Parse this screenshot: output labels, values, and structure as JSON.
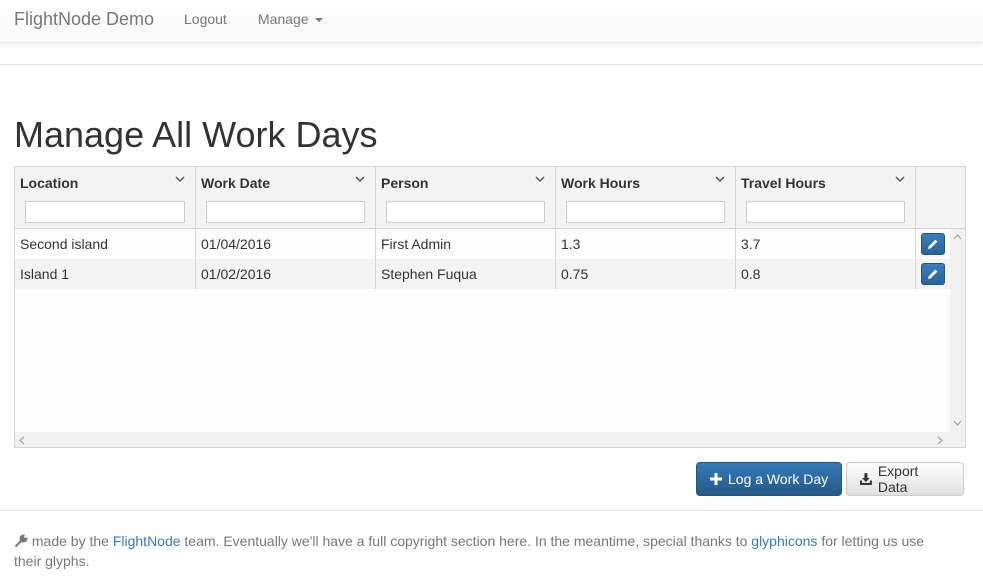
{
  "navbar": {
    "brand": "FlightNode Demo",
    "logout": "Logout",
    "manage": "Manage"
  },
  "page_title": "Manage All Work Days",
  "grid": {
    "columns": [
      {
        "label": "Location",
        "filter": ""
      },
      {
        "label": "Work Date",
        "filter": ""
      },
      {
        "label": "Person",
        "filter": ""
      },
      {
        "label": "Work Hours",
        "filter": ""
      },
      {
        "label": "Travel Hours",
        "filter": ""
      }
    ],
    "rows": [
      {
        "location": "Second island",
        "work_date": "01/04/2016",
        "person": "First Admin",
        "work_hours": "1.3",
        "travel_hours": "3.7"
      },
      {
        "location": "Island 1",
        "work_date": "01/02/2016",
        "person": "Stephen Fuqua",
        "work_hours": "0.75",
        "travel_hours": "0.8"
      }
    ],
    "row_action_icon": "pencil-icon"
  },
  "buttons": {
    "log_work_day": "Log a Work Day",
    "log_work_day_icon": "plus-icon",
    "export_data": "Export Data",
    "export_data_icon": "download-icon"
  },
  "footer": {
    "icon": "wrench-icon",
    "text_before": " made by the ",
    "link_flightnode": "FlightNode",
    "text_middle": " team. Eventually we'll have a full copyright section here. In the meantime, special thanks to ",
    "link_glyphicons": "glyphicons",
    "text_after": " for letting us use their glyphs."
  },
  "colors": {
    "primary": "#337ab7",
    "navbar_text": "#777777",
    "grid_border": "#d4d4d4"
  }
}
